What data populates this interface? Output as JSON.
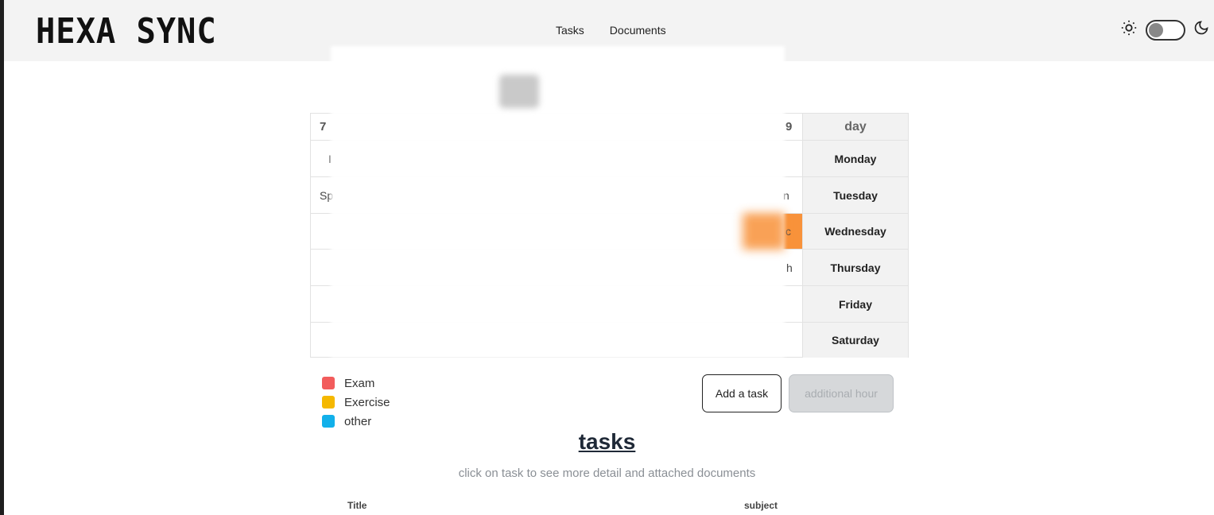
{
  "app": {
    "logo": "HEXA SYNC"
  },
  "nav": {
    "tasks": "Tasks",
    "documents": "Documents"
  },
  "theme": {
    "light_icon": "sun-icon",
    "dark_icon": "moon-icon",
    "mode": "light"
  },
  "timetable": {
    "header_left": "7",
    "header_right": "9",
    "day_header": "day",
    "days": [
      "Monday",
      "Tuesday",
      "Wednesday",
      "Thursday",
      "Friday",
      "Saturday"
    ],
    "left_fragments": [
      "I",
      "Sp",
      "",
      "",
      "",
      ""
    ],
    "right_fragments": [
      "",
      "n",
      "c",
      "h",
      "",
      ""
    ],
    "highlight_color": "#f8923a"
  },
  "legend": [
    {
      "label": "Exam",
      "color": "#f25c5c"
    },
    {
      "label": "Exercise",
      "color": "#f5b800"
    },
    {
      "label": "other",
      "color": "#12b0ea"
    }
  ],
  "actions": {
    "add_task": "Add a task",
    "additional_hour": "additional hour"
  },
  "tasks": {
    "title": "tasks",
    "subtitle": "click on task to see more detail and attached documents",
    "columns": {
      "title": "Title",
      "subject": "subject"
    }
  }
}
